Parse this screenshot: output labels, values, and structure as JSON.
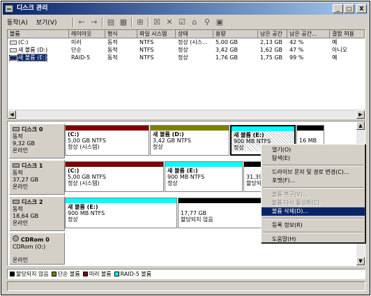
{
  "window": {
    "title": "디스크 관리",
    "min": "_",
    "max": "□",
    "close": "X"
  },
  "menu": [
    "동작(A)",
    "보기(V)"
  ],
  "toolbar": [
    "←",
    "→",
    "▤",
    "▦",
    "⊞",
    "☒",
    "✕",
    "☑",
    "⌂",
    "⚲",
    "▣"
  ],
  "columns": [
    "볼륨",
    "레이아웃",
    "형식",
    "파일 시스템",
    "상태",
    "용량",
    "남은 공간",
    "남은 공간...",
    "결함 허용"
  ],
  "volumes": [
    {
      "name": "(C:)",
      "layout": "미러",
      "type": "동적",
      "fs": "NTFS",
      "status": "정상 (시스...",
      "capacity": "5,00 GB",
      "free": "2,13 GB",
      "pct": "42 %",
      "fault": "예"
    },
    {
      "name": "새 볼륨 (D:)",
      "layout": "단순",
      "type": "동적",
      "fs": "NTFS",
      "status": "정상",
      "capacity": "3,42 GB",
      "free": "1,62 GB",
      "pct": "47 %",
      "fault": "아니오"
    },
    {
      "name": "새 볼륨 (E:)",
      "layout": "RAID-5",
      "type": "동적",
      "fs": "NTFS",
      "status": "정상",
      "capacity": "1,76 GB",
      "free": "1,75 GB",
      "pct": "99 %",
      "fault": "예"
    }
  ],
  "disks": [
    {
      "name": "디스크 0",
      "type": "동적",
      "size": "9,32 GB",
      "state": "온라인"
    },
    {
      "name": "디스크 1",
      "type": "동적",
      "size": "37,27 GB",
      "state": "온라인"
    },
    {
      "name": "디스크 2",
      "type": "동적",
      "size": "18,64 GB",
      "state": "온라인"
    },
    {
      "name": "CDRom 0",
      "type": "CDRom (O:)",
      "size": "",
      "state": "온라인"
    }
  ],
  "parts": {
    "d0c": {
      "name": "(C:)",
      "size": "5,00 GB NTFS",
      "status": "정상 (시스템)"
    },
    "d0d": {
      "name": "새 볼륨 (D:)",
      "size": "3,42 GB NTFS",
      "status": "정상"
    },
    "d0e": {
      "name": "새 볼륨 (E:)",
      "size": "900 MB NTFS",
      "status": "정상"
    },
    "d0u": {
      "size": "16 MB",
      "status": ""
    },
    "d1c": {
      "name": "(C:)",
      "size": "5,00 GB NTFS",
      "status": "정상 (시스템)"
    },
    "d1e": {
      "name": "새 볼륨 (E:)",
      "size": "900 MB NTFS",
      "status": "정상"
    },
    "d1u": {
      "size": "31,39",
      "status": "할당되지"
    },
    "d2e": {
      "name": "새 볼륨 (E:)",
      "size": "900 MB NTFS",
      "status": "정상"
    },
    "d2u": {
      "size": "17,77 GB",
      "status": "할당되지 않음"
    }
  },
  "legend": [
    "할당되지 않음",
    "단순 볼륨",
    "미러 볼륨",
    "RAID-5 볼륨"
  ],
  "colors": {
    "unallocated": "#000000",
    "simple": "#808000",
    "mirror": "#800000",
    "raid5": "#00ffff"
  },
  "context_menu": [
    "열기(O)",
    "탐색(E)",
    "드라이브 문자 및 경로 변경(C)...",
    "포맷(F)...",
    "볼륨 복구(V)...",
    "볼륨 다시 활성화(C)",
    "볼륨 삭제(D)...",
    "등록 정보(R)",
    "도움말(H)"
  ]
}
